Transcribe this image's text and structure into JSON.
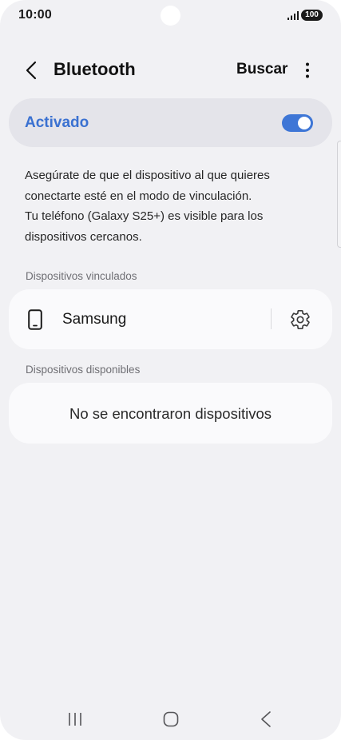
{
  "status_bar": {
    "time": "10:00",
    "battery": "100",
    "signal_icon": "signal-bars-icon"
  },
  "header": {
    "title": "Bluetooth",
    "back_icon": "chevron-left-icon",
    "search_label": "Buscar",
    "more_icon": "more-vertical-icon"
  },
  "bluetooth_toggle": {
    "label": "Activado",
    "enabled": true,
    "accent_color": "#3e76d6"
  },
  "description": {
    "line1": "Asegúrate de que el dispositivo al que quieres",
    "line2": "conectarte esté en el modo de vinculación.",
    "line3": "Tu teléfono (Galaxy S25+) es visible para los",
    "line4": "dispositivos cercanos."
  },
  "paired_devices": {
    "section_label": "Dispositivos vinculados",
    "items": [
      {
        "name": "Samsung",
        "icon": "smartphone-icon",
        "settings_icon": "gear-icon"
      }
    ]
  },
  "available_devices": {
    "section_label": "Dispositivos disponibles",
    "empty_message": "No se encontraron dispositivos"
  },
  "nav_bar": {
    "recent_icon": "recent-apps-icon",
    "home_icon": "home-icon",
    "back_icon": "back-icon"
  }
}
